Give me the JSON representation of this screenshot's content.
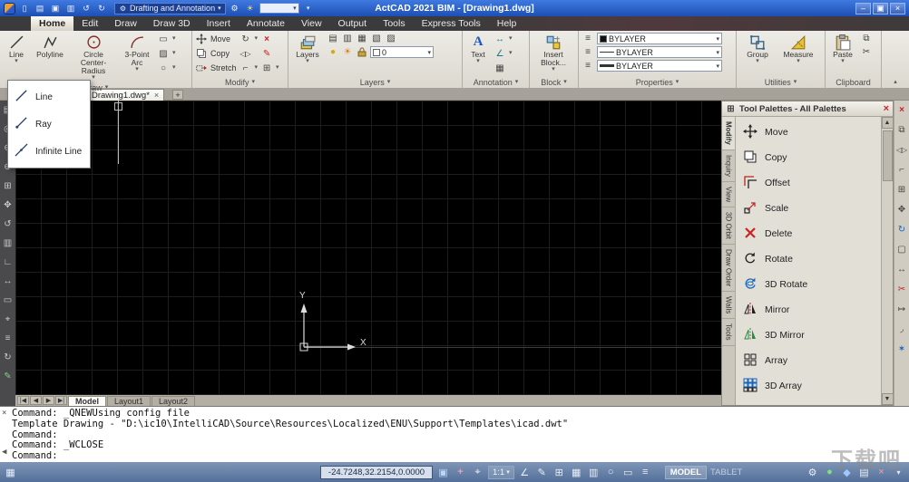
{
  "titlebar": {
    "title": "ActCAD 2021 BIM - [Drawing1.dwg]",
    "workspace": "Drafting and Annotation"
  },
  "menubar": {
    "items": [
      "Home",
      "Edit",
      "Draw",
      "Draw 3D",
      "Insert",
      "Annotate",
      "View",
      "Output",
      "Tools",
      "Express Tools",
      "Help"
    ],
    "active": "Home"
  },
  "ribbon": {
    "draw": {
      "label": "Draw",
      "line": "Line",
      "polyline": "Polyline",
      "circle": "Circle Center-Radius",
      "arc": "3-Point Arc"
    },
    "modify": {
      "label": "Modify",
      "move": "Move",
      "copy": "Copy",
      "stretch": "Stretch"
    },
    "layers": {
      "label": "Layers",
      "button": "Layers",
      "layer_value": "0"
    },
    "annotation": {
      "label": "Annotation",
      "text": "Text"
    },
    "block": {
      "label": "Block",
      "insert": "Insert Block..."
    },
    "properties": {
      "label": "Properties",
      "color_value": "BYLAYER",
      "linetype_value": "BYLAYER",
      "lineweight_value": "BYLAYER"
    },
    "utilities": {
      "label": "Utilities",
      "group": "Group",
      "measure": "Measure"
    },
    "clipboard": {
      "label": "Clipboard",
      "paste": "Paste"
    }
  },
  "line_dropdown": {
    "items": [
      "Line",
      "Ray",
      "Infinite Line"
    ]
  },
  "document": {
    "tab": "Drawing1.dwg*"
  },
  "canvas": {
    "ucs_x": "X",
    "ucs_y": "Y"
  },
  "palette": {
    "title": "Tool Palettes - All Palettes",
    "tabs": [
      "Modify",
      "Inquiry",
      "View",
      "3D Orbit",
      "Draw Order",
      "Walls",
      "Tools"
    ],
    "items": [
      "Move",
      "Copy",
      "Offset",
      "Scale",
      "Delete",
      "Rotate",
      "3D Rotate",
      "Mirror",
      "3D Mirror",
      "Array",
      "3D Array"
    ]
  },
  "layout_tabs": {
    "items": [
      "Model",
      "Layout1",
      "Layout2"
    ],
    "active": "Model"
  },
  "command": {
    "lines": [
      "Command: _QNEWUsing config file",
      "Template Drawing - \"D:\\ic10\\IntelliCAD\\Source\\Resources\\Localized\\ENU\\Support\\Templates\\icad.dwt\"",
      "Command:",
      "Command: _WCLOSE",
      "Command:"
    ]
  },
  "statusbar": {
    "coords": "-24.7248,32.2154,0.0000",
    "scale": "1:1",
    "model_label": "MODEL",
    "tablet_label": "TABLET"
  },
  "watermark": {
    "text": "下载吧"
  },
  "colors": {
    "titlebar_blue": "#2b66d8",
    "canvas_black": "#000000",
    "ribbon_gray": "#dcd8cf",
    "erase_red": "#cc2a2a",
    "accent_blue": "#1a57c8",
    "statusbar_blue": "#54709a"
  }
}
